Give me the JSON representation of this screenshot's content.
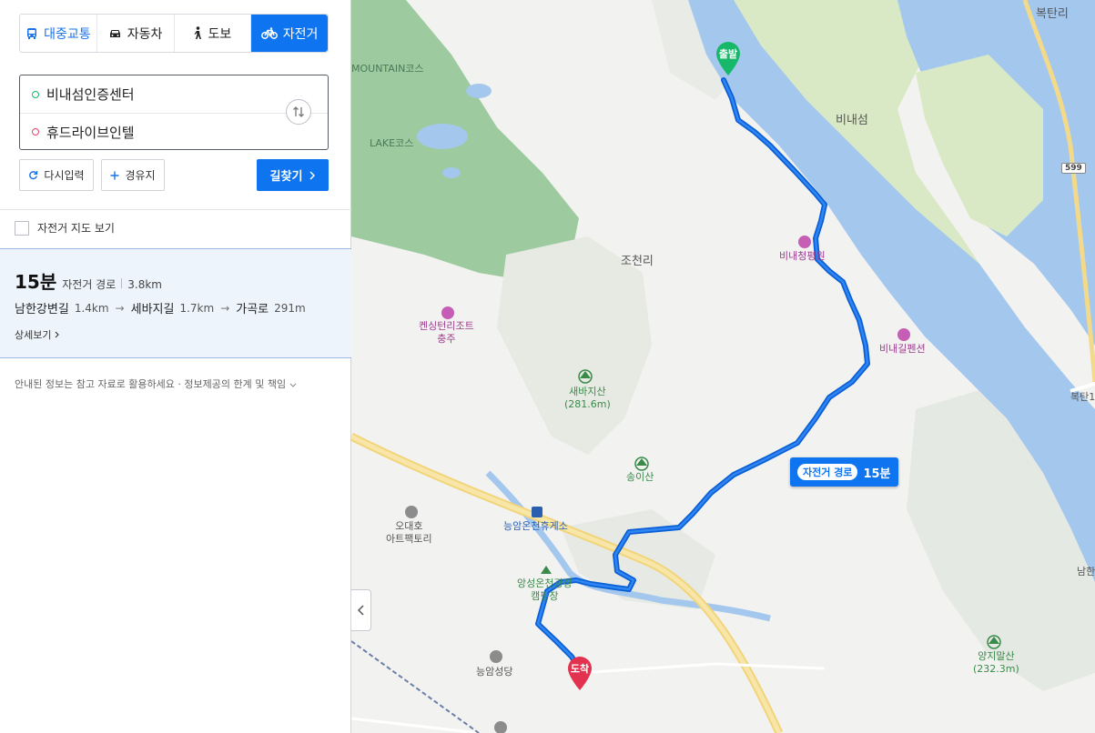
{
  "modes": {
    "transit": "대중교통",
    "car": "자동차",
    "walk": "도보",
    "bike": "자전거"
  },
  "route": {
    "from": "비내섬인증센터",
    "to": "휴드라이브인텔"
  },
  "buttons": {
    "reset": "다시입력",
    "via": "경유지",
    "search": "길찾기"
  },
  "bike_map_label": "자전거 지도 보기",
  "result": {
    "time": "15분",
    "type": "자전거 경로",
    "distance": "3.8km",
    "legs": [
      {
        "road": "남한강변길",
        "dist": "1.4km"
      },
      {
        "road": "세바지길",
        "dist": "1.7km"
      },
      {
        "road": "가곡로",
        "dist": "291m"
      }
    ],
    "detail": "상세보기"
  },
  "notice": "안내된 정보는 참고 자료로 활용하세요 · 정보제공의 한계 및 책임",
  "map": {
    "labels": {
      "boktanri_top": "복탄리",
      "boktanri_right": "복탄1",
      "mountain_course": "MOUNTAIN코스",
      "lake_course": "LAKE코스",
      "binaeseom": "비내섬",
      "jocheonri": "조천리",
      "binae_cheonghwawon": "비내청평원",
      "binaegil_pension": "비내길펜션",
      "kensington_1": "켄싱턴리조트",
      "kensington_2": "충주",
      "saebaji_1": "새바지산",
      "saebaji_2": "(281.6m)",
      "songisan": "송이산",
      "odaeho_1": "오대호",
      "odaeho_2": "아트팩토리",
      "rest_area": "능암온천휴게소",
      "camping_1": "앙성온천광장",
      "camping_2": "캠핑장",
      "neungam_church": "능암성당",
      "yangjimal_1": "양지말산",
      "yangjimal_2": "(232.3m)",
      "namhan_right": "남한"
    },
    "road_shield": "599",
    "start_pin": "출발",
    "end_pin": "도착",
    "tooltip": {
      "type": "자전거 경로",
      "time": "15분"
    },
    "colors": {
      "route": "#0b5fd6",
      "water": "#a4c8ed",
      "golf": "#9ccb9c",
      "start": "#17b86a",
      "end": "#e3324f",
      "accent": "#0f74f0"
    }
  }
}
